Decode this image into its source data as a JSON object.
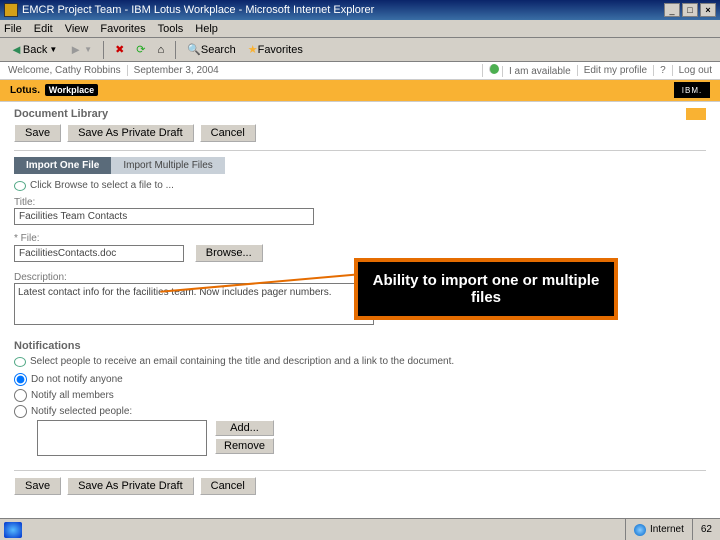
{
  "window": {
    "title": "EMCR Project Team - IBM Lotus Workplace - Microsoft Internet Explorer"
  },
  "menus": {
    "file": "File",
    "edit": "Edit",
    "view": "View",
    "favorites": "Favorites",
    "tools": "Tools",
    "help": "Help"
  },
  "toolbar": {
    "back": "Back",
    "search": "Search",
    "favorites": "Favorites"
  },
  "welcome": {
    "greeting": "Welcome, Cathy Robbins",
    "date": "September 3, 2004",
    "available": "I am available",
    "edit_profile": "Edit my profile",
    "help": "?",
    "logout": "Log out"
  },
  "brand": {
    "lotus": "Lotus.",
    "workplace": "Workplace",
    "ibm": "IBM."
  },
  "page": {
    "doclib": "Document Library",
    "save": "Save",
    "save_draft": "Save As Private Draft",
    "cancel": "Cancel",
    "tab_one": "Import One File",
    "tab_multi": "Import Multiple Files",
    "browse_hint": "Click Browse to select a file to ...",
    "title_label": "Title:",
    "title_value": "Facilities Team Contacts",
    "file_label": "File:",
    "file_value": "FacilitiesContacts.doc",
    "browse": "Browse...",
    "desc_label": "Description:",
    "desc_value": "Latest contact info for the facilities team. Now includes pager numbers.",
    "notif_head": "Notifications",
    "notif_hint": "Select people to receive an email containing the title and description and a link to the document.",
    "opt_none": "Do not notify anyone",
    "opt_all": "Notify all members",
    "opt_sel": "Notify selected people:",
    "add": "Add...",
    "remove": "Remove"
  },
  "callout": "Ability to import one or multiple files",
  "status": {
    "zone": "Internet",
    "slide": "62"
  }
}
